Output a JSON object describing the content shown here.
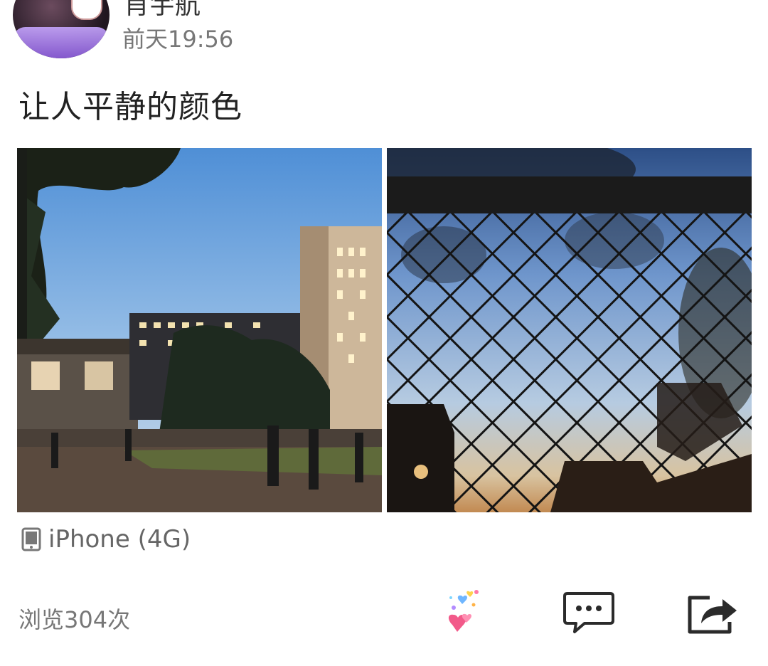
{
  "post": {
    "author": {
      "name": "肖宇航",
      "timestamp": "前天19:56"
    },
    "text": "让人平静的颜色",
    "images": [
      {
        "name": "campus-dusk-photo"
      },
      {
        "name": "chain-link-fence-photo"
      }
    ],
    "device": {
      "icon": "phone-icon",
      "label": "iPhone (4G)"
    },
    "views_label": "浏览304次",
    "actions": {
      "like_icon": "hearts-like-icon",
      "comment_icon": "comment-bubble-icon",
      "share_icon": "share-arrow-icon"
    }
  }
}
